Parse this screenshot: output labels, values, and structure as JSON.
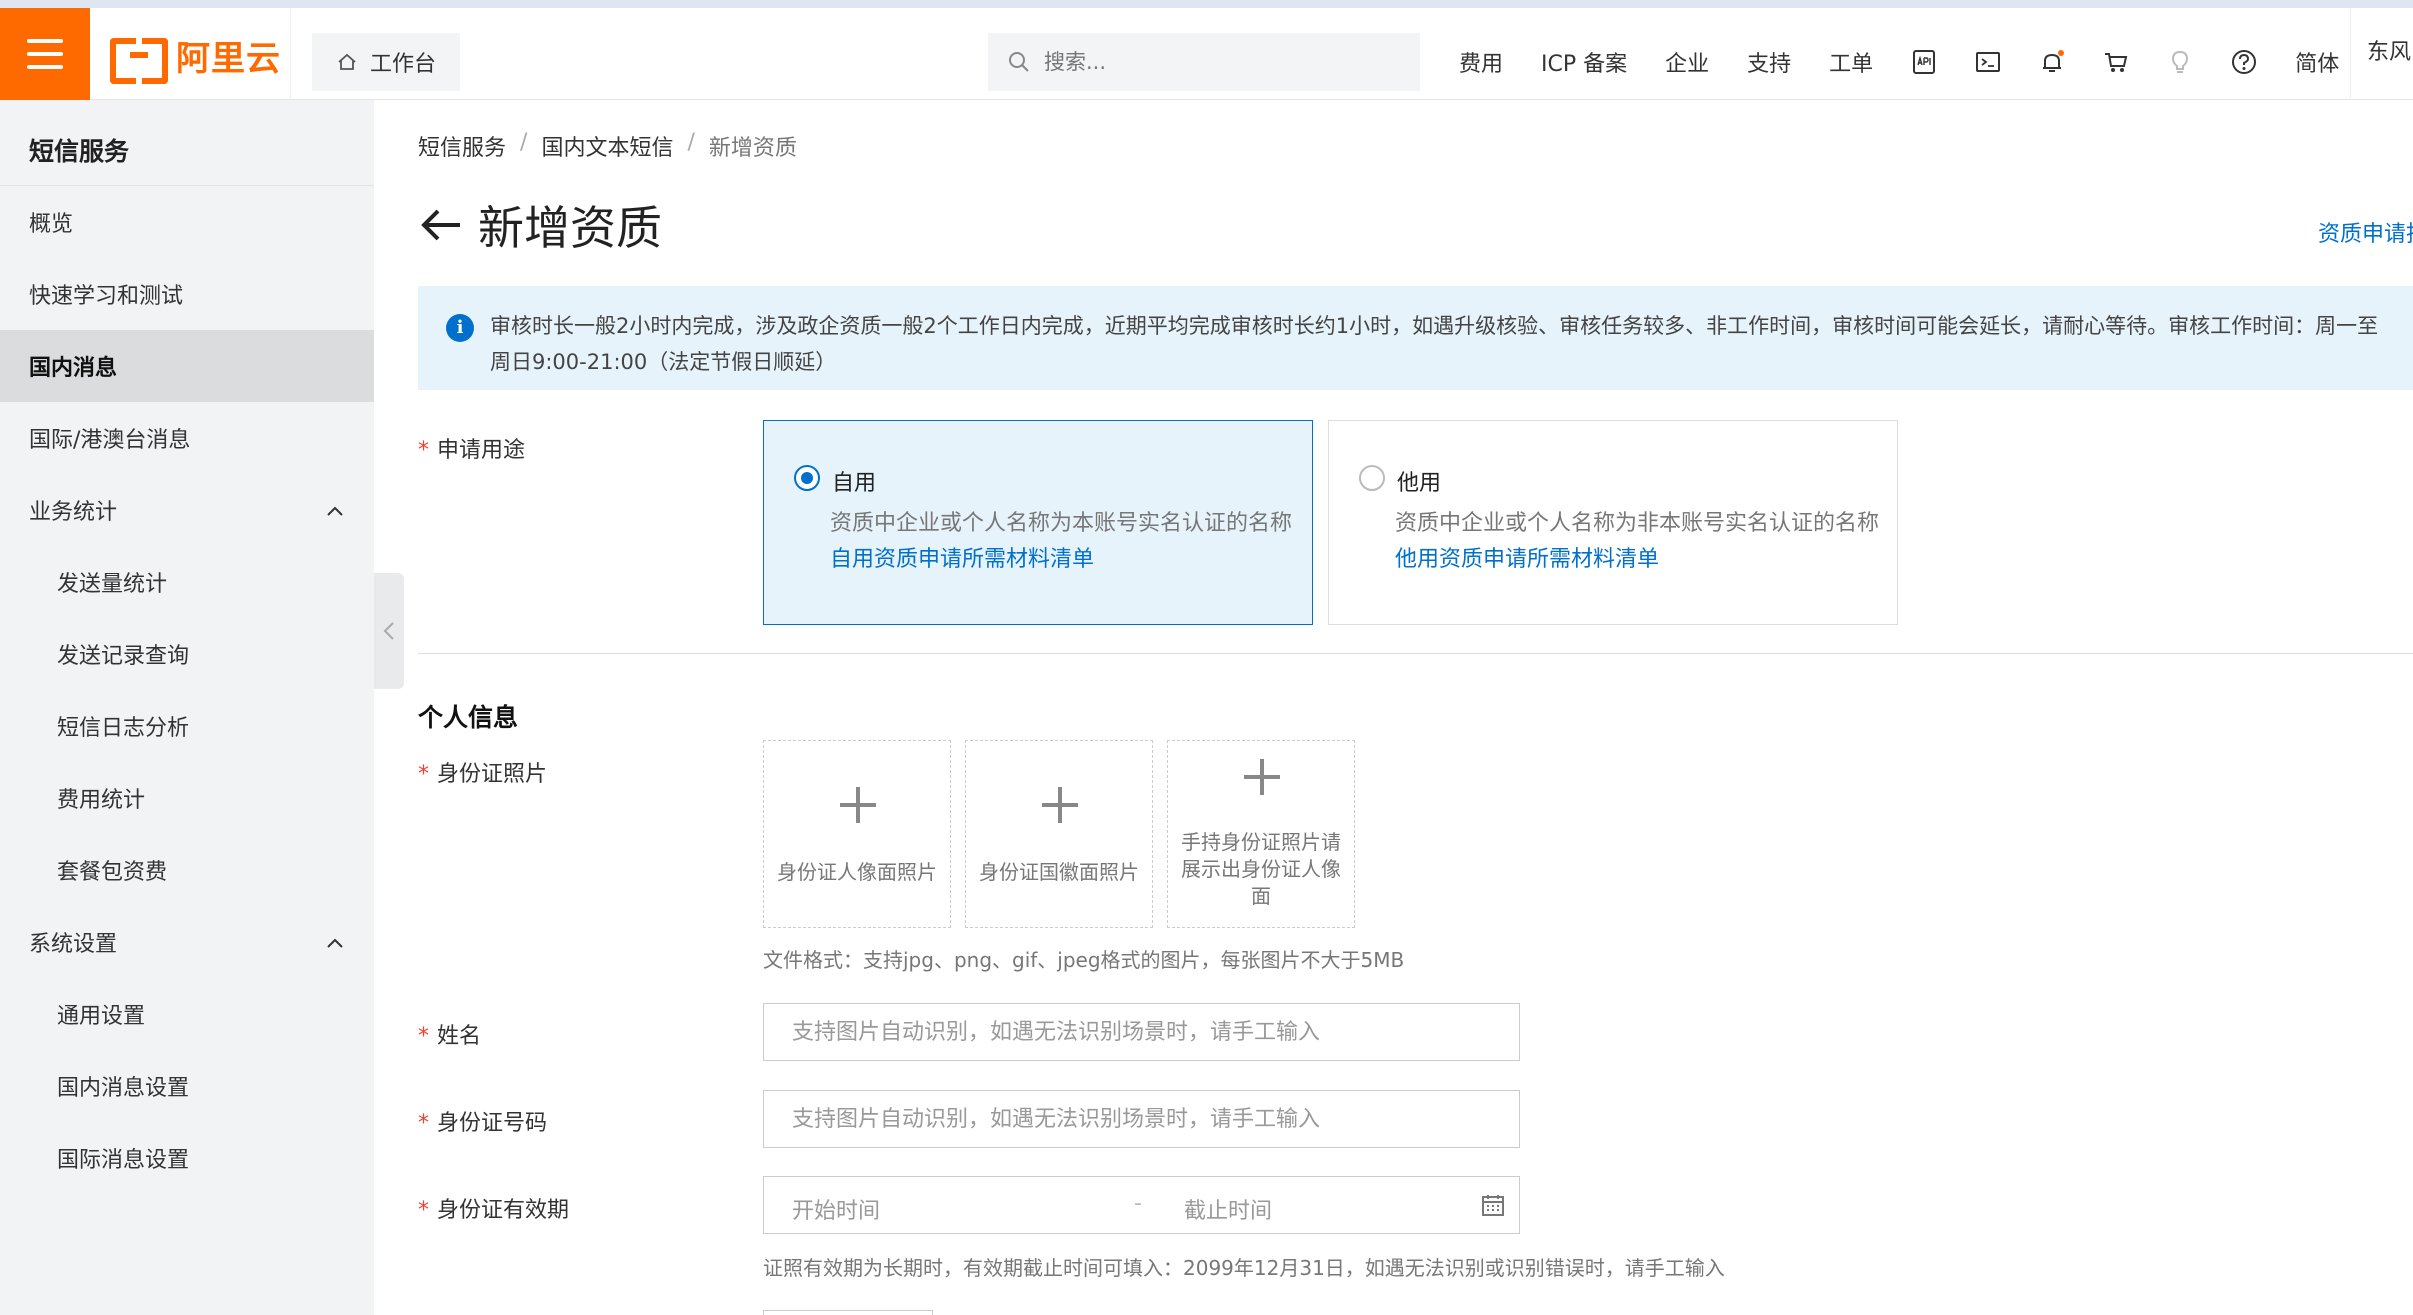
{
  "topbar": {
    "logo_text": "阿里云",
    "workbench_label": "工作台",
    "search_placeholder": "搜索...",
    "nav": [
      "费用",
      "ICP 备案",
      "企业",
      "支持",
      "工单"
    ],
    "lang_label": "简体",
    "user_label": "东风",
    "notification_dot_color": "#ff6a00"
  },
  "sidebar": {
    "title": "短信服务",
    "items": [
      {
        "label": "概览"
      },
      {
        "label": "快速学习和测试"
      },
      {
        "label": "国内消息"
      },
      {
        "label": "国际/港澳台消息"
      },
      {
        "label": "业务统计"
      },
      {
        "label": "发送量统计"
      },
      {
        "label": "发送记录查询"
      },
      {
        "label": "短信日志分析"
      },
      {
        "label": "费用统计"
      },
      {
        "label": "套餐包资费"
      },
      {
        "label": "系统设置"
      },
      {
        "label": "通用设置"
      },
      {
        "label": "国内消息设置"
      },
      {
        "label": "国际消息设置"
      }
    ]
  },
  "breadcrumb": [
    "短信服务",
    "国内文本短信",
    "新增资质"
  ],
  "page": {
    "title": "新增资质",
    "title_link": "资质申请指",
    "notice_line1": "审核时长一般2小时内完成，涉及政企资质一般2个工作日内完成，近期平均完成审核时长约1小时，如遇升级核验、审核任务较多、非工作时间，审核时间可能会延长，请耐心等待。审核工作时间：周一至",
    "notice_line2": "周日9:00-21:00（法定节假日顺延）"
  },
  "form": {
    "purpose_label": "申请用途",
    "options": [
      {
        "title": "自用",
        "desc": "资质中企业或个人名称为本账号实名认证的名称",
        "link": "自用资质申请所需材料清单",
        "selected": true
      },
      {
        "title": "他用",
        "desc": "资质中企业或个人名称为非本账号实名认证的名称",
        "link": "他用资质申请所需材料清单",
        "selected": false
      }
    ],
    "section_title": "个人信息",
    "id_photo_label": "身份证照片",
    "uploads": [
      {
        "label": "身份证人像面照片"
      },
      {
        "label": "身份证国徽面照片"
      },
      {
        "label": "手持身份证照片请展示出身份证人像面"
      }
    ],
    "upload_hint": "文件格式：支持jpg、png、gif、jpeg格式的图片，每张图片不大于5MB",
    "name_label": "姓名",
    "name_placeholder": "支持图片自动识别，如遇无法识别场景时，请手工输入",
    "idno_label": "身份证号码",
    "idno_placeholder": "支持图片自动识别，如遇无法识别场景时，请手工输入",
    "validity_label": "身份证有效期",
    "start_placeholder": "开始时间",
    "range_separator": "-",
    "end_placeholder": "截止时间",
    "validity_hint": "证照有效期为长期时，有效期截止时间可填入：2099年12月31日，如遇无法识别或识别错误时，请手工输入"
  },
  "colors": {
    "brand": "#ff6a00",
    "accent": "#0070cc",
    "required": "#f04134",
    "notice_bg": "#e6f3fb"
  }
}
